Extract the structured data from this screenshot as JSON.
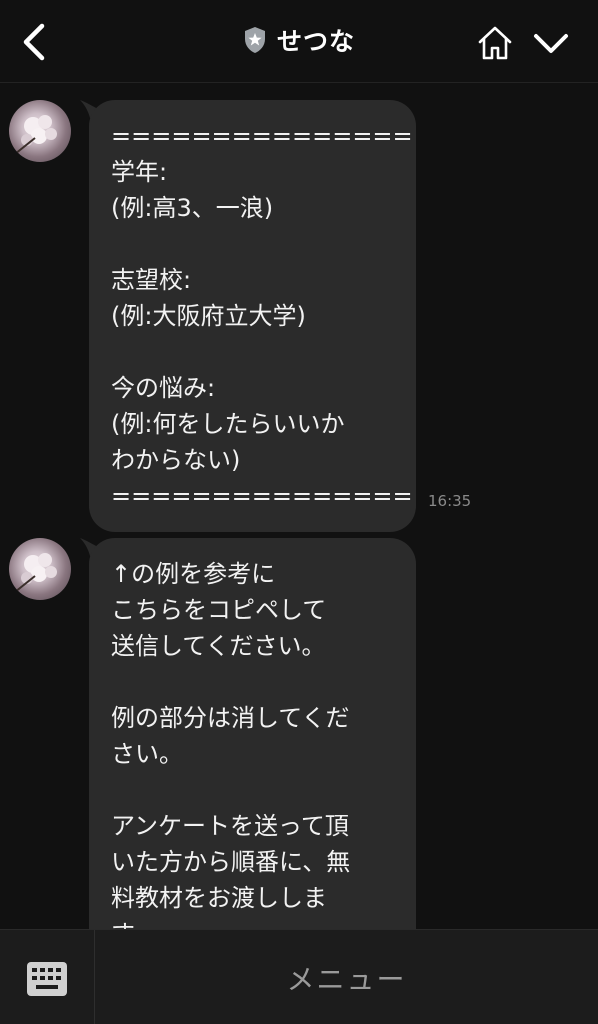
{
  "header": {
    "title": "せつな",
    "back_icon": "chevron-left-icon",
    "badge_icon": "shield-star-icon",
    "home_icon": "home-icon",
    "menu_toggle_icon": "chevron-down-icon"
  },
  "messages": [
    {
      "sender_avatar": "avatar-cherry-blossom",
      "lines": [
        "===============",
        "学年:",
        "(例:高3、一浪)",
        "",
        "志望校:",
        "(例:大阪府立大学)",
        "",
        "今の悩み:",
        "(例:何をしたらいいか",
        "わからない)",
        "==============="
      ],
      "time": "16:35"
    },
    {
      "sender_avatar": "avatar-cherry-blossom",
      "lines": [
        "↑の例を参考に",
        "こちらをコピペして",
        "送信してください。",
        "",
        "例の部分は消してくだ",
        "さい。",
        "",
        "アンケートを送って頂",
        "いた方から順番に、無",
        "料教材をお渡ししま",
        "す。"
      ]
    }
  ],
  "bottom_bar": {
    "keyboard_icon": "keyboard-icon",
    "menu_label": "メニュー"
  },
  "colors": {
    "background": "#111111",
    "bubble": "#2b2b2b",
    "text": "#f2f2f2",
    "timestamp": "#8a8a8a",
    "bottom_bar": "#1c1c1c"
  }
}
